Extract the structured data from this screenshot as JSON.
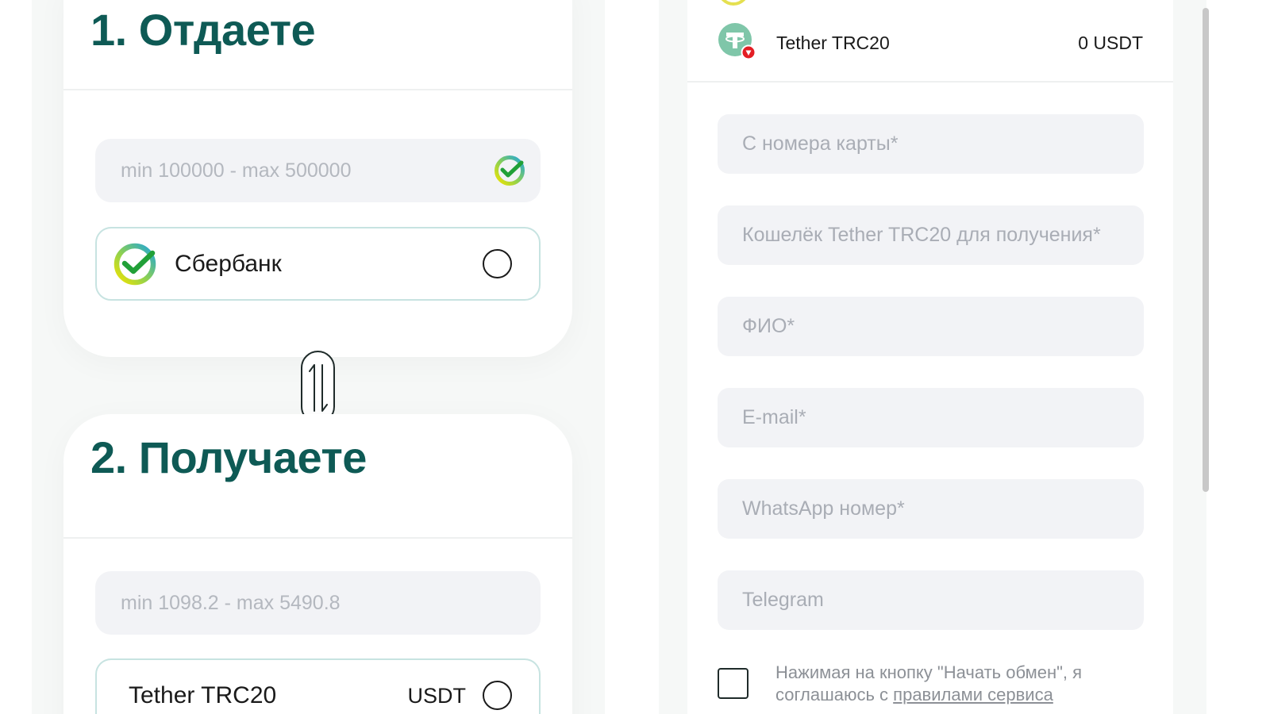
{
  "give": {
    "title": "1. Отдаете",
    "amount_placeholder": "min 100000 - max 500000",
    "option": {
      "name": "Сбербанк",
      "icon": "sberbank-logo-icon"
    }
  },
  "swap": {
    "icon": "swap-arrows-icon"
  },
  "receive": {
    "title": "2. Получаете",
    "amount_placeholder": "min 1098.2 - max 5490.8",
    "option": {
      "name": "Tether TRC20",
      "currency": "USDT"
    }
  },
  "right": {
    "coin": {
      "name": "Tether TRC20",
      "balance": "0 USDT",
      "icon": "tether-trc20-icon"
    },
    "fields": {
      "card_placeholder": "С номера карты*",
      "wallet_placeholder": "Кошелёк Tether TRC20 для получения*",
      "fio_placeholder": "ФИО*",
      "email_placeholder": "E-mail*",
      "whatsapp_placeholder": "WhatsApp номер*",
      "telegram_placeholder": "Telegram"
    },
    "agreement": {
      "text": "Нажимая на кнопку \"Начать обмен\", я соглашаюсь с ",
      "link": "правилами сервиса"
    }
  },
  "colors": {
    "title": "#0e5a55",
    "option_border": "#c7e3e1",
    "field_bg": "#f2f3f6"
  }
}
